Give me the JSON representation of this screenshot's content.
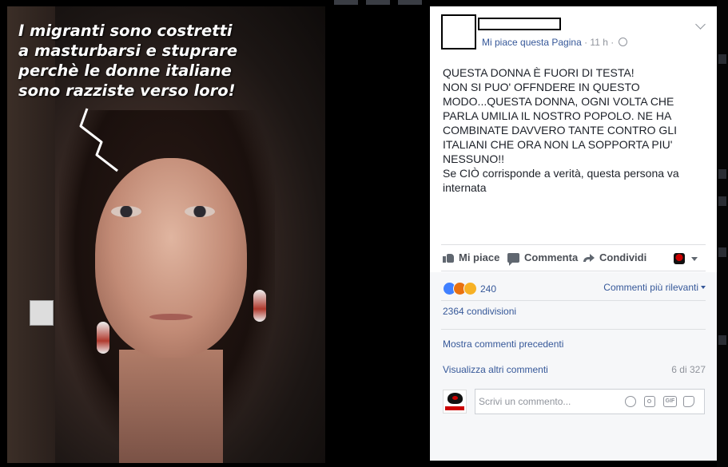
{
  "image_overlay": {
    "lines": [
      "I migranti  sono costretti",
      "a masturbarsi e stuprare",
      "perchè le donne italiane",
      "sono razziste verso loro!"
    ]
  },
  "post": {
    "meta": {
      "like_page": "Mi piace questa Pagina",
      "time": "· 11 h ·"
    },
    "text_lines": [
      "QUESTA DONNA È FUORI DI TESTA!",
      "NON SI PUO' OFFNDERE IN QUESTO",
      "MODO...QUESTA DONNA, OGNI VOLTA CHE",
      "PARLA UMILIA IL NOSTRO POPOLO. NE HA",
      "COMBINATE DAVVERO TANTE CONTRO GLI",
      "ITALIANI CHE ORA NON LA SOPPORTA PIU'",
      "NESSUNO!!",
      "Se CIÒ corrisponde a verità, questa persona va",
      "internata"
    ],
    "actions": {
      "like": "Mi piace",
      "comment": "Commenta",
      "share": "Condividi"
    },
    "reactions_count": "240",
    "sort_label": "Commenti più rilevanti",
    "shares_label": "2364 condivisioni",
    "previous_comments": "Mostra commenti precedenti",
    "more_comments": "Visualizza altri commenti",
    "comment_counter": "6 di 327",
    "composer_placeholder": "Scrivi un commento..."
  },
  "colors": {
    "link": "#365899",
    "meta": "#90949c",
    "like_reaction": "#4080ff",
    "angry_reaction": "#e9710f",
    "haha_reaction": "#f7b125"
  }
}
